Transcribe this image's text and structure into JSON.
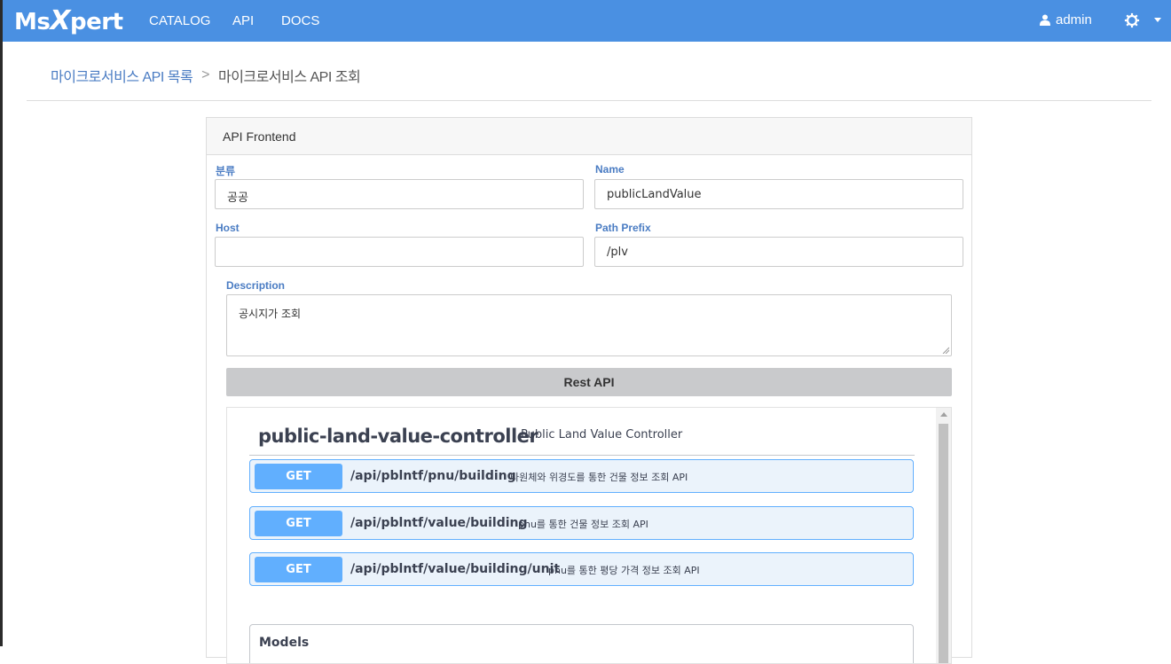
{
  "navbar": {
    "logo_prefix": "Ms",
    "logo_x": "X",
    "logo_suffix": "pert",
    "links": [
      "CATALOG",
      "API",
      "DOCS"
    ],
    "user": "admin",
    "color": "#4a90e2"
  },
  "breadcrumb": {
    "parent": "마이크로서비스 API 목록",
    "separator": ">",
    "current": "마이크로서비스 API 조회"
  },
  "panel": {
    "title": "API Frontend",
    "fields": {
      "category": {
        "label": "분류",
        "value": "공공"
      },
      "name": {
        "label": "Name",
        "value": "publicLandValue"
      },
      "host": {
        "label": "Host",
        "value": ""
      },
      "path_prefix": {
        "label": "Path Prefix",
        "value": "/plv"
      },
      "description": {
        "label": "Description",
        "value": "공시지가 조회"
      }
    },
    "rest_button": "Rest API"
  },
  "swagger": {
    "controller_name": "public-land-value-controller",
    "controller_desc": "Public Land Value Controller",
    "operations": [
      {
        "method": "GET",
        "path": "/api/pblntf/pnu/building",
        "summary": "타원체와 위경도를 통한 건물 정보 조회 API"
      },
      {
        "method": "GET",
        "path": "/api/pblntf/value/building",
        "summary": "pnu를 통한 건물 정보 조회 API"
      },
      {
        "method": "GET",
        "path": "/api/pblntf/value/building/unit",
        "summary": "pnu를 통한 평당 가격 정보 조회 API"
      }
    ],
    "models_title": "Models",
    "get_color": "#61affe"
  }
}
